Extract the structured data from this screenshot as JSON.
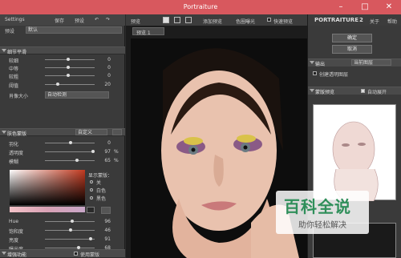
{
  "titlebar": {
    "title": "Portraiture",
    "minimize": "–",
    "maximize": "□",
    "close": "✕"
  },
  "left": {
    "settings_label": "Settings",
    "save": "保存",
    "preset": "预设",
    "preset_row": {
      "label": "预设",
      "value": "默认"
    },
    "detail_section": {
      "title": "细节平滑",
      "sliders": [
        {
          "label": "较细",
          "value": "0"
        },
        {
          "label": "中等",
          "value": "0"
        },
        {
          "label": "较粗",
          "value": "0"
        },
        {
          "label": "阈值",
          "value": "20"
        }
      ],
      "portrait_size_label": "肖像大小",
      "portrait_size_value": "自动检测"
    },
    "mask_section": {
      "title": "肤色蒙版",
      "mode": "自定义",
      "sliders": [
        {
          "label": "羽化",
          "value": "0"
        },
        {
          "label": "透明度",
          "value": "97",
          "unit": "%"
        },
        {
          "label": "模糊",
          "value": "65",
          "unit": "%"
        }
      ],
      "show_mask_label": "显示蒙版：",
      "radio": [
        "关",
        "白色",
        "黑色"
      ],
      "color_sliders": [
        {
          "label": "Hue",
          "value": "96"
        },
        {
          "label": "饱和度",
          "value": "46"
        },
        {
          "label": "亮度",
          "value": "91"
        },
        {
          "label": "曝光度",
          "value": "68"
        }
      ]
    },
    "enhance_section": {
      "title": "增强功能",
      "use_mask": "使用蒙版"
    }
  },
  "center": {
    "preview_label": "预览",
    "add_preview": "添加预览",
    "color_sample": "色圈曝光",
    "quick_preview": "快速预览",
    "brand": "PORTRAITURE",
    "version": "2",
    "about": "关于",
    "help": "帮助",
    "tab": "预览 1"
  },
  "right": {
    "ok": "确定",
    "cancel": "取消",
    "output_title": "输出",
    "output_value": "当前图层",
    "new_layer": "创建透明图层",
    "mask_preview_title": "蒙版预览",
    "auto_expand": "自动展开"
  },
  "watermark": {
    "main": "百科全说",
    "sub": "助你轻松解决"
  }
}
